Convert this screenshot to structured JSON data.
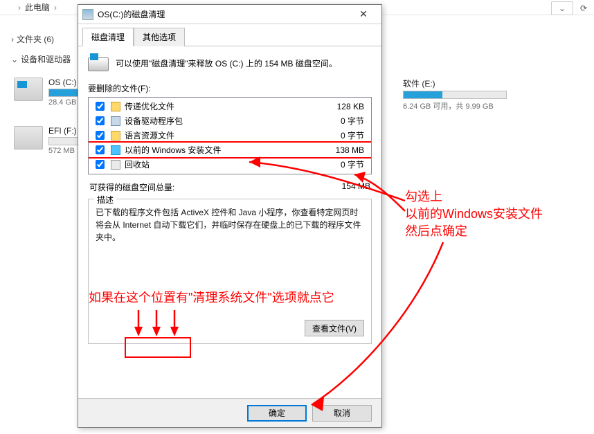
{
  "explorer": {
    "breadcrumb": "此电脑",
    "sidebar": {
      "folders_label": "文件夹 (6)",
      "devices_label": "设备和驱动器"
    },
    "drives": [
      {
        "name": "OS (C:)",
        "meta": "28.4 GB",
        "fill_pct": 70
      },
      {
        "name": "EFI (F:)",
        "meta": "572 MB",
        "fill_pct": 0
      },
      {
        "name": "软件 (E:)",
        "meta": "6.24 GB 可用，共 9.99 GB",
        "fill_pct": 38
      }
    ]
  },
  "dialog": {
    "title": "OS(C:)的磁盘清理",
    "tabs": {
      "cleanup": "磁盘清理",
      "other": "其他选项"
    },
    "intro": "可以使用\"磁盘清理\"来释放 OS (C:) 上的 154 MB 磁盘空间。",
    "files_to_delete_label": "要删除的文件(F):",
    "file_items": [
      {
        "checked": true,
        "icon": "folder",
        "name": "传递优化文件",
        "size": "128 KB"
      },
      {
        "checked": true,
        "icon": "box",
        "name": "设备驱动程序包",
        "size": "0 字节"
      },
      {
        "checked": true,
        "icon": "folder",
        "name": "语言资源文件",
        "size": "0 字节"
      },
      {
        "checked": true,
        "icon": "win",
        "name": "以前的 Windows 安装文件",
        "size": "138 MB",
        "highlight": true
      },
      {
        "checked": true,
        "icon": "bin",
        "name": "回收站",
        "size": "0 字节"
      }
    ],
    "total_label": "可获得的磁盘空间总量:",
    "total_value": "154 MB",
    "desc_legend": "描述",
    "desc_text": "已下载的程序文件包括 ActiveX 控件和 Java 小程序，你查看特定网页时将会从 Internet 自动下载它们，并临时保存在硬盘上的已下载的程序文件夹中。",
    "view_files_btn": "查看文件(V)",
    "ok_btn": "确定",
    "cancel_btn": "取消"
  },
  "annotations": {
    "right_line1": "勾选上",
    "right_line2": "以前的Windows安装文件",
    "right_line3": "然后点确定",
    "bottom_text": "如果在这个位置有\"清理系统文件\"选项就点它"
  }
}
